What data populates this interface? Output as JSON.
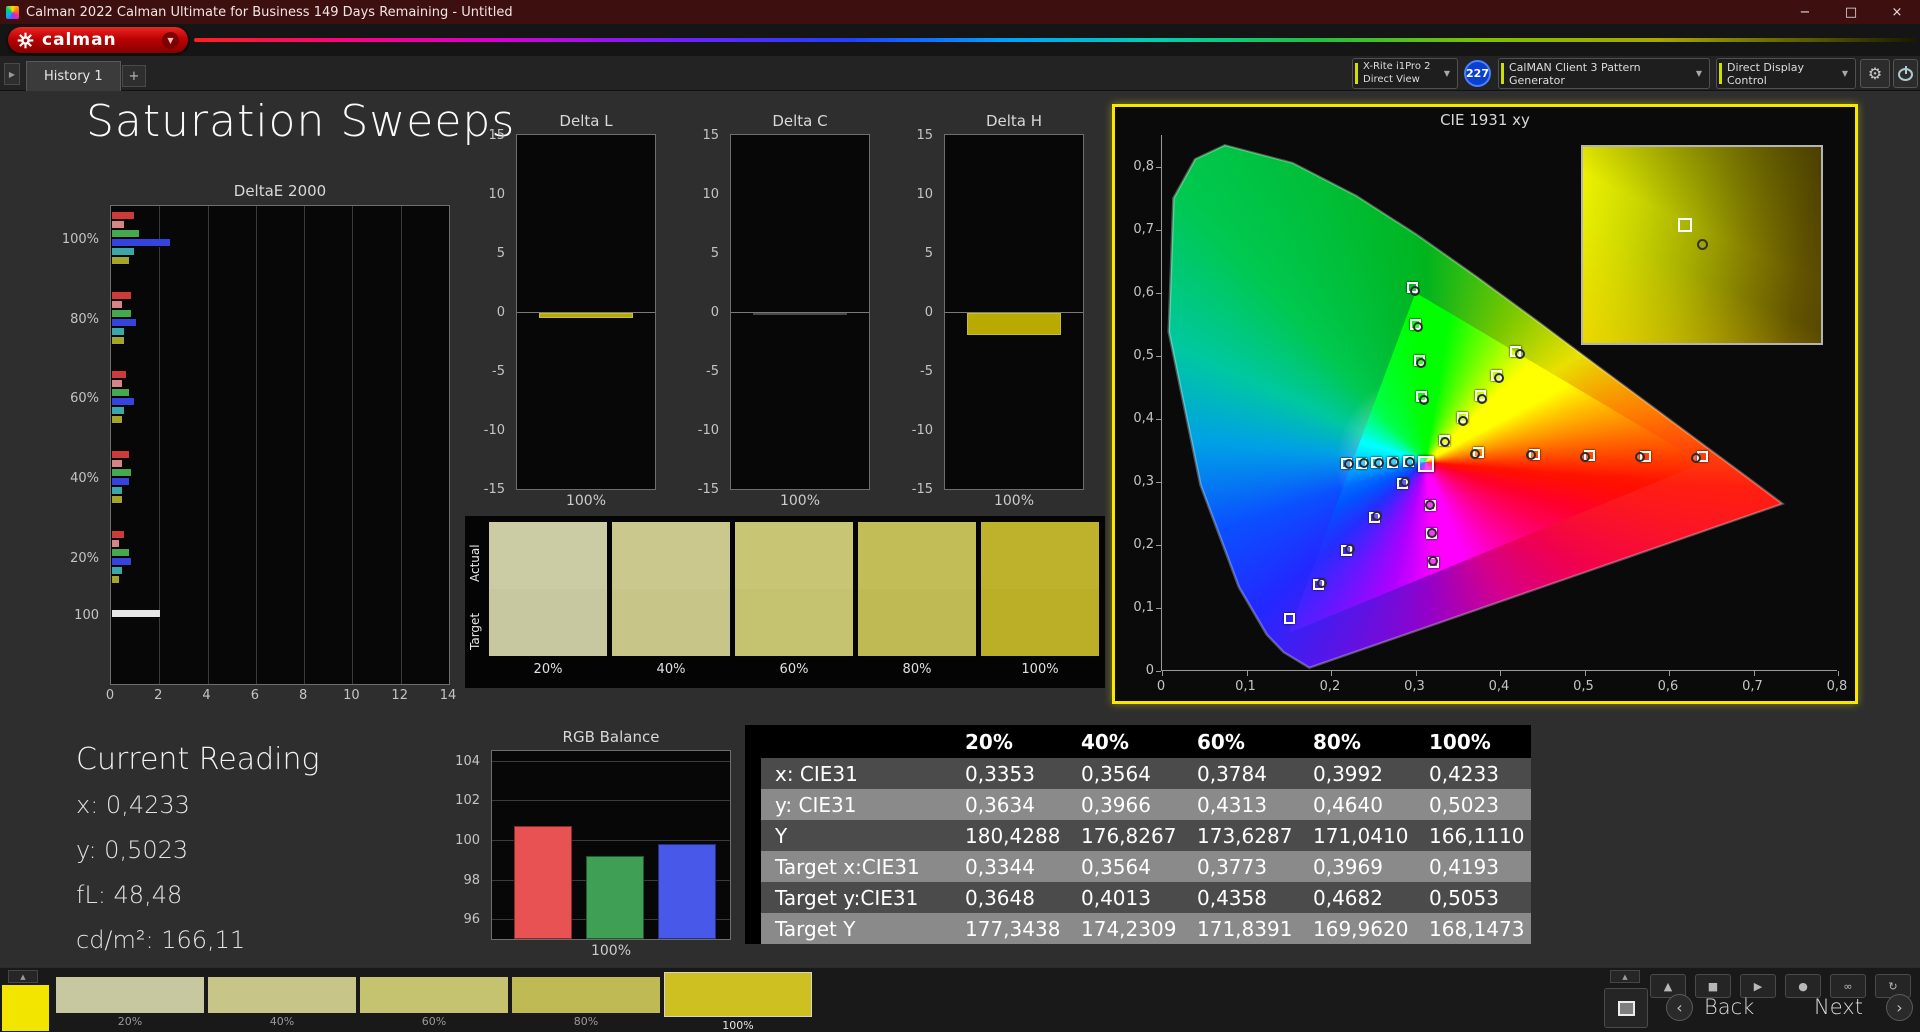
{
  "window": {
    "title": "Calman 2022 Calman Ultimate for Business 149 Days Remaining  - Untitled",
    "minimize_icon": "−",
    "maximize_icon": "□",
    "close_icon": "×"
  },
  "brand": {
    "name": "calman",
    "caret_icon": "▼"
  },
  "tabbar": {
    "rail_icon": "▶",
    "history_tab": "History 1",
    "add_tab": "+"
  },
  "devicebar": {
    "meter_line1": "X-Rite i1Pro 2",
    "meter_line2": "Direct View",
    "meter_badge": "227",
    "pattern_label": "CalMAN Client 3 Pattern Generator",
    "display_label": "Direct Display Control",
    "caret_icon": "▼",
    "gear_icon": "⚙",
    "accent_color": "#cfe000"
  },
  "page": {
    "title": "Saturation Sweeps"
  },
  "current_reading": {
    "title": "Current Reading",
    "lines": [
      "x: 0,4233",
      "y: 0,5023",
      "fL: 48,48",
      "cd/m²: 166,11"
    ]
  },
  "chart_data": [
    {
      "type": "bar",
      "orientation": "horizontal",
      "title": "DeltaE 2000",
      "xlim": [
        0,
        14
      ],
      "xticks": [
        0,
        2,
        4,
        6,
        8,
        10,
        12,
        14
      ],
      "groups": [
        {
          "label": "100%",
          "bars": [
            {
              "color": "#cc3a3a",
              "value": 0.9
            },
            {
              "color": "#d58585",
              "value": 0.5
            },
            {
              "color": "#46a84d",
              "value": 1.1
            },
            {
              "color": "#3644dd",
              "value": 2.4
            },
            {
              "color": "#3aa8a8",
              "value": 0.9
            },
            {
              "color": "#a4a428",
              "value": 0.7
            }
          ]
        },
        {
          "label": "80%",
          "bars": [
            {
              "color": "#cc3a3a",
              "value": 0.8
            },
            {
              "color": "#d58585",
              "value": 0.4
            },
            {
              "color": "#46a84d",
              "value": 0.8
            },
            {
              "color": "#3644dd",
              "value": 1.0
            },
            {
              "color": "#3aa8a8",
              "value": 0.5
            },
            {
              "color": "#a4a428",
              "value": 0.5
            }
          ]
        },
        {
          "label": "60%",
          "bars": [
            {
              "color": "#cc3a3a",
              "value": 0.6
            },
            {
              "color": "#d58585",
              "value": 0.4
            },
            {
              "color": "#46a84d",
              "value": 0.7
            },
            {
              "color": "#3644dd",
              "value": 0.9
            },
            {
              "color": "#3aa8a8",
              "value": 0.5
            },
            {
              "color": "#a4a428",
              "value": 0.4
            }
          ]
        },
        {
          "label": "40%",
          "bars": [
            {
              "color": "#cc3a3a",
              "value": 0.7
            },
            {
              "color": "#d58585",
              "value": 0.4
            },
            {
              "color": "#46a84d",
              "value": 0.8
            },
            {
              "color": "#3644dd",
              "value": 0.7
            },
            {
              "color": "#3aa8a8",
              "value": 0.4
            },
            {
              "color": "#a4a428",
              "value": 0.4
            }
          ]
        },
        {
          "label": "20%",
          "bars": [
            {
              "color": "#cc3a3a",
              "value": 0.5
            },
            {
              "color": "#d58585",
              "value": 0.3
            },
            {
              "color": "#46a84d",
              "value": 0.7
            },
            {
              "color": "#3644dd",
              "value": 0.8
            },
            {
              "color": "#3aa8a8",
              "value": 0.4
            },
            {
              "color": "#a4a428",
              "value": 0.3
            }
          ]
        },
        {
          "label": "100",
          "bars": [
            {
              "color": "#e6e6e6",
              "value": 2.0
            }
          ]
        }
      ]
    },
    {
      "type": "bar",
      "title": "Delta L",
      "ylim": [
        -15,
        15
      ],
      "yticks": [
        15,
        10,
        5,
        0,
        -5,
        -10,
        -15
      ],
      "categories": [
        "100%"
      ],
      "values": [
        -0.4
      ],
      "color": "#b8aa00",
      "xlabel": "100%"
    },
    {
      "type": "bar",
      "title": "Delta C",
      "ylim": [
        -15,
        15
      ],
      "yticks": [
        15,
        10,
        5,
        0,
        -5,
        -10,
        -15
      ],
      "categories": [
        "100%"
      ],
      "values": [
        -0.2
      ],
      "color": "#161616",
      "xlabel": "100%"
    },
    {
      "type": "bar",
      "title": "Delta H",
      "ylim": [
        -15,
        15
      ],
      "yticks": [
        15,
        10,
        5,
        0,
        -5,
        -10,
        -15
      ],
      "categories": [
        "100%"
      ],
      "values": [
        -1.9
      ],
      "color": "#b8aa00",
      "xlabel": "100%"
    },
    {
      "type": "bar",
      "title": "RGB Balance",
      "ylim": [
        95,
        104.5
      ],
      "yticks": [
        96,
        98,
        100,
        102,
        104
      ],
      "xlabel": "100%",
      "series": [
        {
          "name": "Red",
          "color": "#e85252",
          "value": 100.7
        },
        {
          "name": "Green",
          "color": "#3fa055",
          "value": 99.2
        },
        {
          "name": "Blue",
          "color": "#4858e8",
          "value": 99.8
        }
      ]
    },
    {
      "type": "scatter",
      "title": "CIE 1931 xy",
      "xlim": [
        0,
        0.8
      ],
      "ylim": [
        0,
        0.85
      ],
      "xticks": [
        "0",
        "0,1",
        "0,2",
        "0,3",
        "0,4",
        "0,5",
        "0,6",
        "0,7",
        "0,8"
      ],
      "yticks": [
        "0",
        "0,1",
        "0,2",
        "0,3",
        "0,4",
        "0,5",
        "0,6",
        "0,7",
        "0,8"
      ],
      "white_point": [
        0.3127,
        0.329
      ],
      "sweeps": [
        {
          "name": "yellow",
          "targets": [
            [
              0.3344,
              0.3648
            ],
            [
              0.3564,
              0.4013
            ],
            [
              0.3773,
              0.4358
            ],
            [
              0.3969,
              0.4682
            ],
            [
              0.4193,
              0.5053
            ]
          ],
          "measured": [
            [
              0.3353,
              0.3634
            ],
            [
              0.3564,
              0.3966
            ],
            [
              0.3784,
              0.4313
            ],
            [
              0.3992,
              0.464
            ],
            [
              0.4233,
              0.5023
            ]
          ]
        },
        {
          "name": "red",
          "targets": [
            [
              0.375,
              0.345
            ],
            [
              0.442,
              0.343
            ],
            [
              0.506,
              0.341
            ],
            [
              0.573,
              0.34
            ],
            [
              0.64,
              0.339
            ]
          ],
          "measured": [
            [
              0.371,
              0.344
            ],
            [
              0.437,
              0.342
            ],
            [
              0.5,
              0.34
            ],
            [
              0.566,
              0.339
            ],
            [
              0.632,
              0.338
            ]
          ]
        },
        {
          "name": "green",
          "targets": [
            [
              0.308,
              0.434
            ],
            [
              0.305,
              0.492
            ],
            [
              0.301,
              0.549
            ],
            [
              0.297,
              0.607
            ]
          ],
          "measured": [
            [
              0.31,
              0.43
            ],
            [
              0.306,
              0.488
            ],
            [
              0.303,
              0.545
            ],
            [
              0.299,
              0.603
            ]
          ]
        },
        {
          "name": "blue",
          "targets": [
            [
              0.285,
              0.296
            ],
            [
              0.252,
              0.243
            ],
            [
              0.219,
              0.19
            ],
            [
              0.186,
              0.137
            ],
            [
              0.152,
              0.082
            ]
          ],
          "measured": [
            [
              0.288,
              0.299
            ],
            [
              0.255,
              0.246
            ],
            [
              0.222,
              0.193
            ],
            [
              0.189,
              0.14
            ]
          ]
        },
        {
          "name": "cyan",
          "targets": [
            [
              0.292,
              0.331
            ],
            [
              0.273,
              0.33
            ],
            [
              0.255,
              0.33
            ],
            [
              0.237,
              0.329
            ],
            [
              0.219,
              0.329
            ]
          ],
          "measured": [
            [
              0.294,
              0.332
            ],
            [
              0.275,
              0.331
            ],
            [
              0.257,
              0.33
            ],
            [
              0.239,
              0.33
            ],
            [
              0.221,
              0.329
            ]
          ]
        },
        {
          "name": "magenta",
          "targets": [
            [
              0.318,
              0.262
            ],
            [
              0.32,
              0.217
            ],
            [
              0.322,
              0.172
            ]
          ],
          "measured": [
            [
              0.317,
              0.264
            ],
            [
              0.319,
              0.219
            ],
            [
              0.321,
              0.174
            ]
          ]
        }
      ]
    }
  ],
  "swatch_panel": {
    "row_labels": [
      "Actual",
      "Target"
    ],
    "items": [
      {
        "label": "20%",
        "actual": "#cbcba4",
        "target": "#c8c8a0"
      },
      {
        "label": "40%",
        "actual": "#cac88c",
        "target": "#c7c588"
      },
      {
        "label": "60%",
        "actual": "#c8c574",
        "target": "#c5c270"
      },
      {
        "label": "80%",
        "actual": "#c3bd58",
        "target": "#c0ba54"
      },
      {
        "label": "100%",
        "actual": "#beb22c",
        "target": "#bbaf28"
      }
    ]
  },
  "table": {
    "columns": [
      "",
      "20%",
      "40%",
      "60%",
      "80%",
      "100%"
    ],
    "rows": [
      {
        "label": "x: CIE31",
        "values": [
          "0,3353",
          "0,3564",
          "0,3784",
          "0,3992",
          "0,4233"
        ]
      },
      {
        "label": "y: CIE31",
        "values": [
          "0,3634",
          "0,3966",
          "0,4313",
          "0,4640",
          "0,5023"
        ]
      },
      {
        "label": "Y",
        "values": [
          "180,4288",
          "176,8267",
          "173,6287",
          "171,0410",
          "166,1110"
        ]
      },
      {
        "label": "Target x:CIE31",
        "values": [
          "0,3344",
          "0,3564",
          "0,3773",
          "0,3969",
          "0,4193"
        ]
      },
      {
        "label": "Target y:CIE31",
        "values": [
          "0,3648",
          "0,4013",
          "0,4358",
          "0,4682",
          "0,5053"
        ]
      },
      {
        "label": "Target Y",
        "values": [
          "177,3438",
          "174,2309",
          "171,8391",
          "169,9620",
          "168,1473"
        ]
      }
    ]
  },
  "bottom": {
    "expander_icon": "▲",
    "patch_color": "#f2e600",
    "patches": [
      {
        "label": "20%",
        "color": "#c8c8a0",
        "selected": false
      },
      {
        "label": "40%",
        "color": "#c7c588",
        "selected": false
      },
      {
        "label": "60%",
        "color": "#c5c270",
        "selected": false
      },
      {
        "label": "80%",
        "color": "#c0ba54",
        "selected": false
      },
      {
        "label": "100%",
        "color": "#cfc022",
        "selected": true
      }
    ],
    "tool_icons": [
      "▲",
      "■",
      "▶",
      "●",
      "∞",
      "↻"
    ],
    "back_chevron": "‹",
    "next_chevron": "›",
    "back_label": "Back",
    "next_label": "Next"
  }
}
